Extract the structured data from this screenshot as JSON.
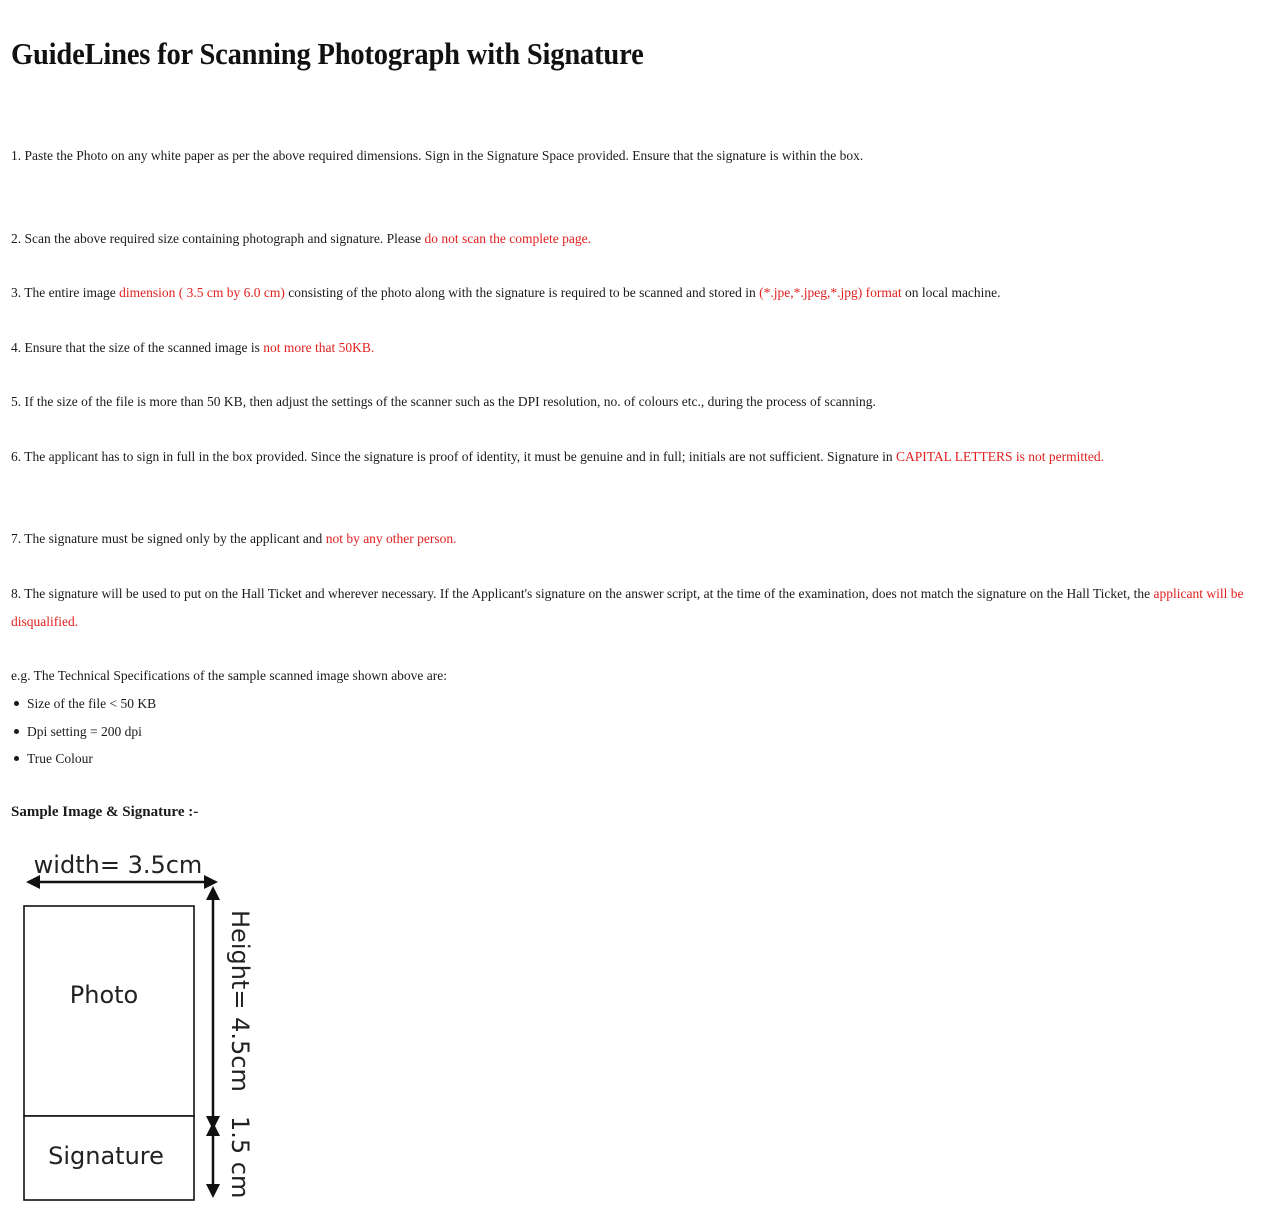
{
  "page": {
    "title": "GuideLines for Scanning Photograph with Signature"
  },
  "guidelines": [
    [
      {
        "text": "1. Paste the Photo on any white paper as per the above required dimensions. Sign in the Signature Space provided. Ensure that the signature is within the box.",
        "red": false
      }
    ],
    [
      {
        "text": "2. Scan the above required size containing photograph and signature. Please ",
        "red": false
      },
      {
        "text": "do not scan the complete page.",
        "red": true
      }
    ],
    [
      {
        "text": "3. The entire image ",
        "red": false
      },
      {
        "text": "dimension ( 3.5 cm by 6.0 cm)",
        "red": true
      },
      {
        "text": " consisting of the photo along with the signature is required to be scanned and stored in ",
        "red": false
      },
      {
        "text": "(*.jpe,*.jpeg,*.jpg) format",
        "red": true
      },
      {
        "text": " on local machine.",
        "red": false
      }
    ],
    [
      {
        "text": "4. Ensure that the size of the scanned image is ",
        "red": false
      },
      {
        "text": "not more that 50KB.",
        "red": true
      }
    ],
    [
      {
        "text": "5. If the size of the file is more than 50 KB, then adjust the settings of the scanner such as the DPI resolution, no. of colours etc., during the process of scanning.",
        "red": false
      }
    ],
    [
      {
        "text": "6. The applicant has to sign in full in the box provided. Since the signature is proof of identity, it must be genuine and in full; initials are not sufficient. Signature in ",
        "red": false
      },
      {
        "text": "CAPITAL LETTERS is not permitted.",
        "red": true
      }
    ],
    [
      {
        "text": "7. The signature must be signed only by the applicant and ",
        "red": false
      },
      {
        "text": "not by any other person.",
        "red": true
      }
    ],
    [
      {
        "text": "8. The signature will be used to put on the Hall Ticket and wherever necessary. If the Applicant's signature on the answer script, at the time of the examination, does not match the signature on the Hall Ticket, the ",
        "red": false
      },
      {
        "text": "applicant will be disqualified.",
        "red": true
      }
    ]
  ],
  "specs": {
    "intro": "e.g. The Technical Specifications of the sample scanned image shown above are:",
    "items": [
      "Size of the file < 50 KB",
      "Dpi setting = 200 dpi",
      "True Colour"
    ]
  },
  "sample": {
    "heading": "Sample Image & Signature :-",
    "width_label": "width= 3.5cm",
    "height_label": "Height= 4.5cm",
    "sig_height_label": "1.5 cm",
    "photo_label": "Photo",
    "signature_label": "Signature"
  },
  "colors": {
    "emphasis": "#e02020",
    "text": "#1a1a1a"
  }
}
